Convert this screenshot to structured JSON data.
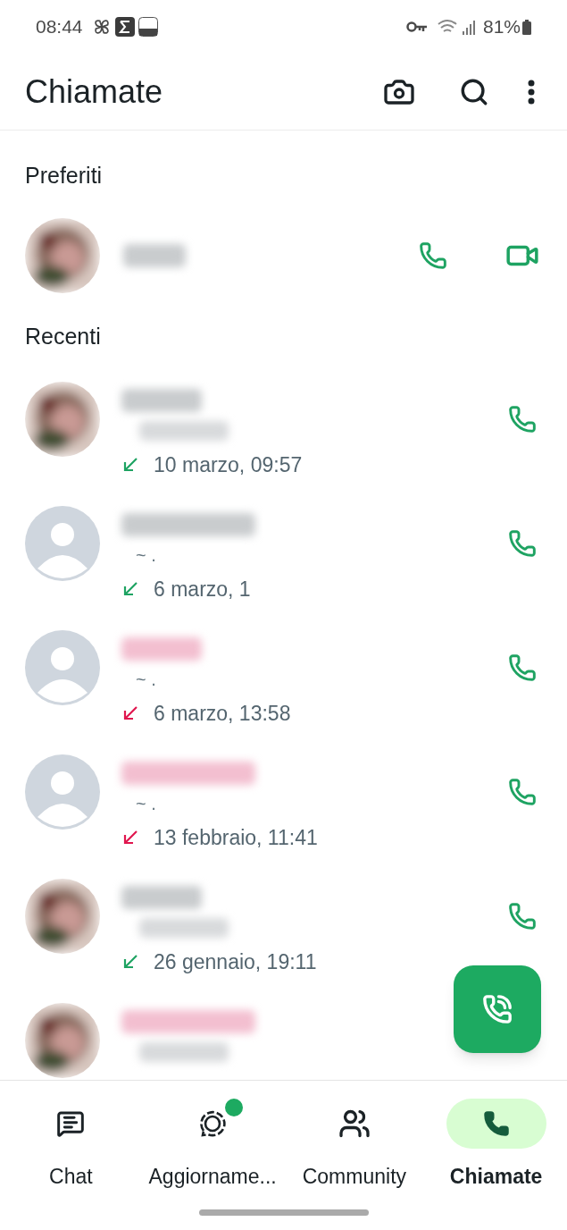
{
  "status_bar": {
    "time": "08:44",
    "battery": "81%"
  },
  "header": {
    "title": "Chiamate"
  },
  "favorites": {
    "heading": "Preferiti"
  },
  "recents": {
    "heading": "Recenti",
    "items": [
      {
        "kind": "incoming",
        "time": "10 marzo, 09:57"
      },
      {
        "avatar": {
          "kind": "default"
        },
        "subtitle": "~ .",
        "kind": "incoming",
        "time": "6 marzo, 1"
      },
      {
        "avatar": {
          "kind": "default"
        },
        "subtitle": "~ .",
        "kind": "missed",
        "time": "6 marzo, 13:58"
      },
      {
        "avatar": {
          "kind": "default"
        },
        "subtitle": "~ .",
        "kind": "missed",
        "time": "13 febbraio, 11:41"
      },
      {
        "kind": "incoming",
        "time": "26 gennaio, 19:11"
      },
      {
        "kind": "missed"
      }
    ]
  },
  "nav": [
    {
      "label": "Chat",
      "selected": false,
      "badge": false
    },
    {
      "label": "Aggiorname...",
      "selected": false,
      "badge": true
    },
    {
      "label": "Community",
      "selected": false,
      "badge": false
    },
    {
      "label": "Chiamate",
      "selected": true,
      "badge": false
    }
  ]
}
